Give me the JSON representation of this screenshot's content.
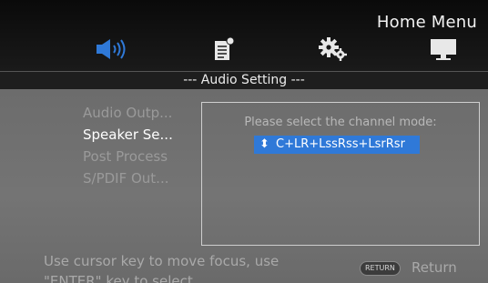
{
  "header": {
    "title": "Home Menu",
    "tabs": [
      {
        "name": "audio",
        "icon": "speaker-icon",
        "active": true
      },
      {
        "name": "document",
        "icon": "document-icon",
        "active": false
      },
      {
        "name": "settings",
        "icon": "gear-icon",
        "active": false
      },
      {
        "name": "display",
        "icon": "monitor-icon",
        "active": false
      }
    ]
  },
  "section": {
    "title": "--- Audio Setting ---"
  },
  "menu": {
    "items": [
      {
        "label": "Audio Outp...",
        "state": "normal"
      },
      {
        "label": "Speaker Se...",
        "state": "focused"
      },
      {
        "label": "Post Process",
        "state": "normal"
      },
      {
        "label": "S/PDIF Out...",
        "state": "normal"
      }
    ]
  },
  "panel": {
    "prompt": "Please select the channel mode:",
    "selected_value": "C+LR+LssRss+LsrRsr",
    "updown_glyph": "⬍"
  },
  "footer": {
    "help_line1": "Use cursor key to move focus, use",
    "help_line2": "\"ENTER\" key to select.",
    "return_key": "RETURN",
    "return_label": "Return"
  },
  "colors": {
    "accent": "#2f79d8",
    "active_icon": "#2f79d8",
    "inactive_icon": "#e8e8e8"
  }
}
